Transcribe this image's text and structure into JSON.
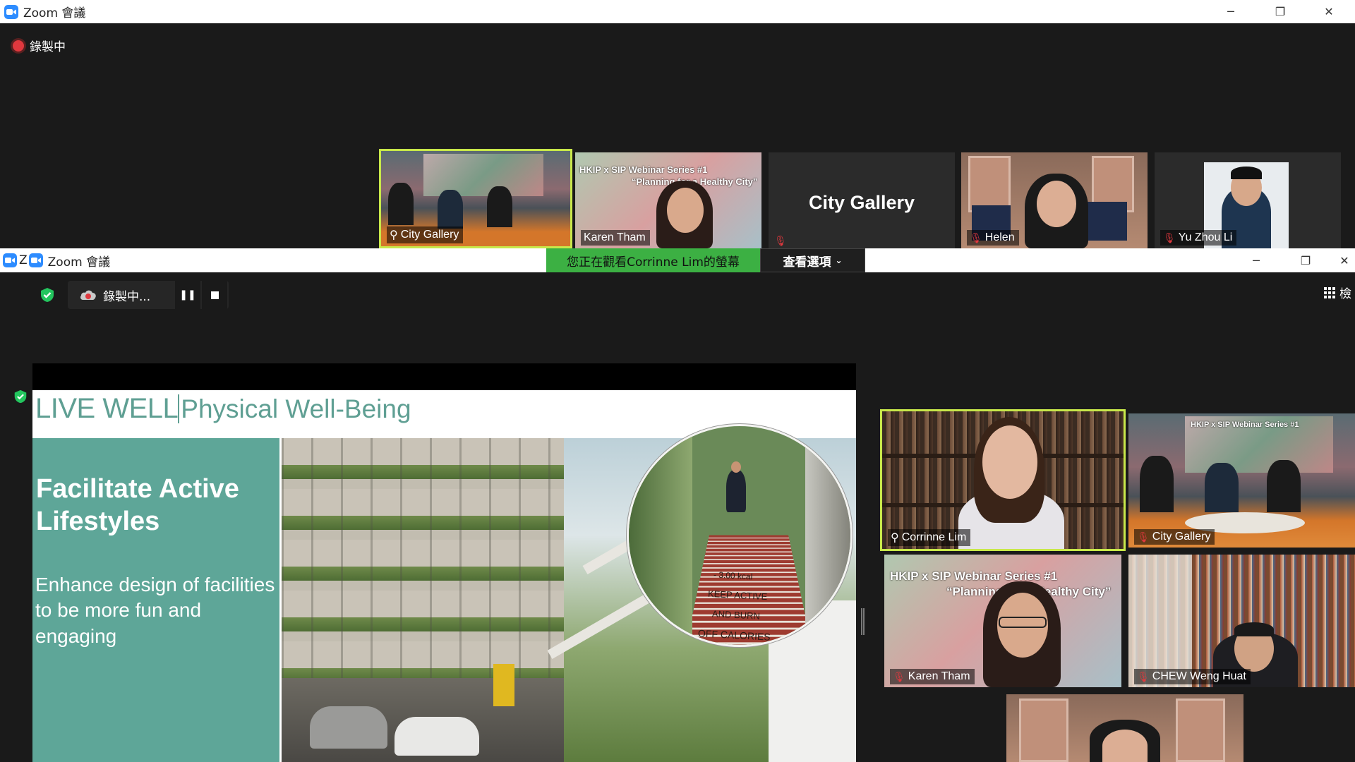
{
  "back_window": {
    "title": "Zoom 會議",
    "recording_label": "錄製中",
    "thumbnails": [
      {
        "name": "City Gallery",
        "kind": "room",
        "muted": false,
        "active": true
      },
      {
        "name": "Karen Tham",
        "kind": "banner",
        "muted": false,
        "active": false,
        "banner_line1": "HKIP x SIP Webinar Series #1",
        "banner_line2": "“Planning for a Healthy City”"
      },
      {
        "name": "",
        "kind": "text",
        "muted": true,
        "active": false,
        "text": "City Gallery"
      },
      {
        "name": "Helen",
        "kind": "helen",
        "muted": true,
        "active": false
      },
      {
        "name": "Yu Zhou Li",
        "kind": "portrait",
        "muted": true,
        "active": false
      }
    ]
  },
  "front_window": {
    "title": "Zoom 會議",
    "title_prefix": "Z",
    "viewing_banner": "您正在觀看Corrinne  Lim的螢幕",
    "view_options_label": "查看選項",
    "recording_label": "錄製中...",
    "gallery_label": "檢",
    "slide": {
      "brand": "LIVE WELL",
      "section": "Physical Well-Being",
      "title": "Facilitate Active Lifestyles",
      "subtitle": "Enhance design of facilities to be more fun and engaging",
      "stair_lines": [
        "- 3.00 kcal",
        "KEEP ACTIVE",
        "AND BURN",
        "OFF CALORIES"
      ]
    },
    "participants": [
      {
        "name": "Corrinne Lim",
        "kind": "bookshelf",
        "muted": false,
        "active": true
      },
      {
        "name": "City Gallery",
        "kind": "room",
        "muted": true,
        "active": false
      },
      {
        "name": "Karen Tham",
        "kind": "banner",
        "muted": true,
        "active": false,
        "banner_line1": "HKIP x SIP Webinar Series #1",
        "banner_line2": "“Planning for a Healthy City”"
      },
      {
        "name": "CHEW Weng Huat",
        "kind": "library",
        "muted": true,
        "active": false
      },
      {
        "name": "",
        "kind": "helen",
        "muted": false,
        "active": false
      }
    ]
  },
  "colors": {
    "active_border": "#c8e84a",
    "zoom_blue": "#2d8cff",
    "teal": "#5ea698",
    "green_banner": "#3cb043",
    "muted_red": "#e0383e"
  }
}
